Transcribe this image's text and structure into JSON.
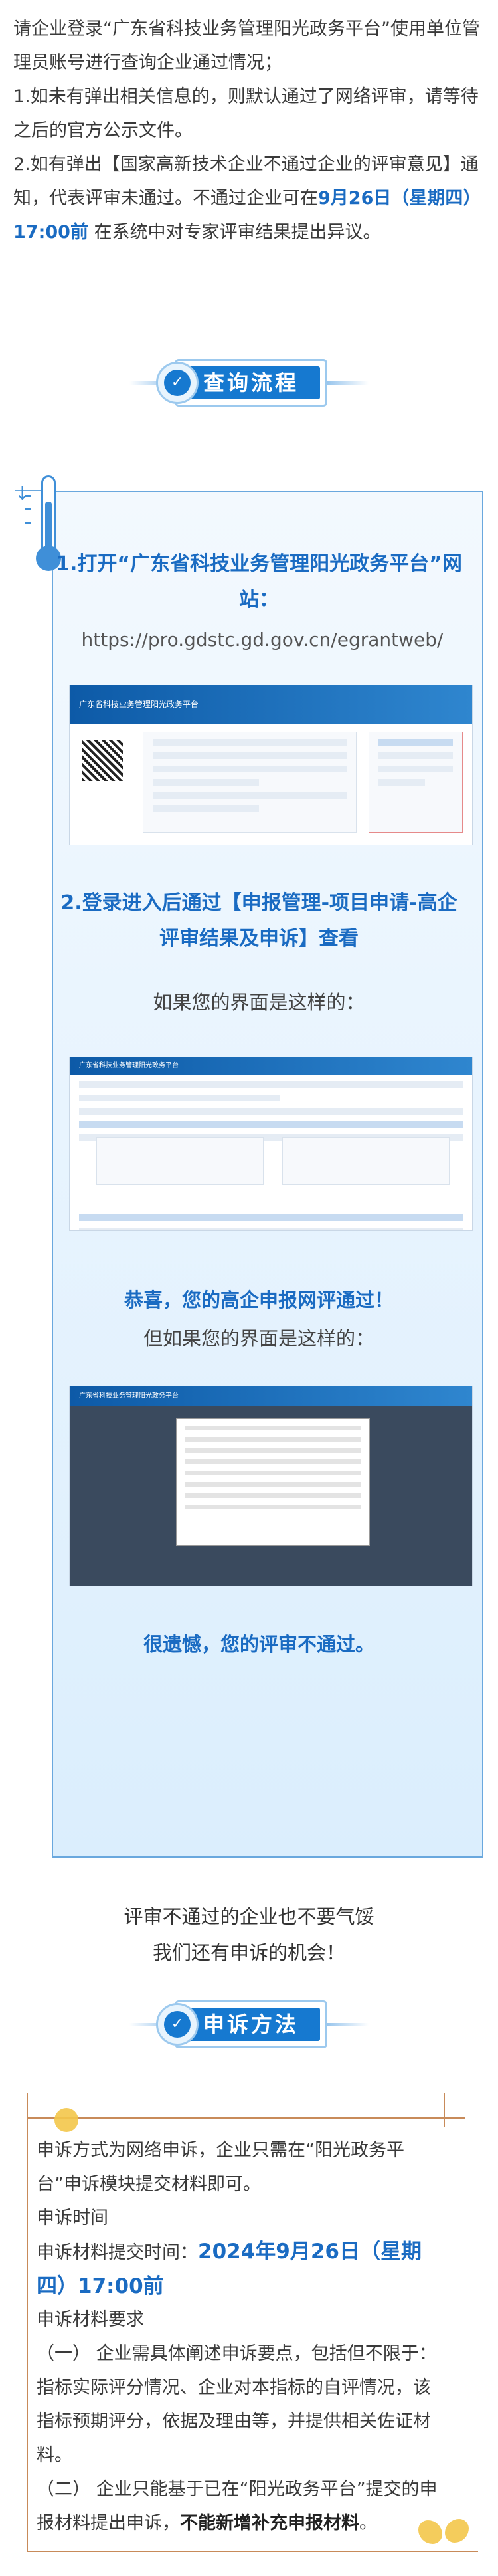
{
  "intro": {
    "p1": "请企业登录“广东省科技业务管理阳光政务平台”使用单位管理员账号进行查询企业通过情况；",
    "p2": "1.如未有弹出相关信息的，则默认通过了网络评审，请等待之后的官方公示文件。",
    "p3a": "2.如有弹出【国家高新技术企业不通过企业的评审意见】通知，代表评审未通过。不通过企业可在",
    "p3b": "9月26日（星期四）17:00前",
    "p3c": " 在系统中对专家评审结果提出异议。"
  },
  "sections": {
    "query_title": "查询流程",
    "appeal_title": "申诉方法"
  },
  "steps": {
    "step1_title": "1.打开“广东省科技业务管理阳光政务平台”网站：",
    "step1_url": "https://pro.gdstc.gd.gov.cn/egrantweb/",
    "step2_title": "2.登录进入后通过【申报管理-项目申请-高企评审结果及申诉】查看",
    "if_like_this": "如果您的界面是这样的：",
    "pass_msg": "恭喜，您的高企申报网评通过！",
    "but_if": "但如果您的界面是这样的：",
    "fail_msg": "很遗憾，您的评审不通过。"
  },
  "screenshots": {
    "s1_header": "广东省科技业务管理阳光政务平台",
    "s2_header": "广东省科技业务管理阳光政务平台",
    "s3_header": "广东省科技业务管理阳光政务平台"
  },
  "closing": {
    "line1": "评审不通过的企业也不要气馁",
    "line2": "我们还有申诉的机会！"
  },
  "appeal": {
    "p1": "申诉方式为网络申诉，企业只需在“阳光政务平台”申诉模块提交材料即可。",
    "time_label": "申诉时间",
    "submit_label": "申诉材料提交时间：",
    "submit_time": "2024年9月26日（星期四）17:00前",
    "req_label": "申诉材料要求",
    "req1": "（一） 企业需具体阐述申诉要点，包括但不限于：指标实际评分情况、企业对本指标的自评情况，该指标预期评分，依据及理由等，并提供相关佐证材料。",
    "req2a": "（二） 企业只能基于已在“阳光政务平台”提交的申报材料提出申诉，",
    "req2b": "不能新增补充申报材料",
    "req2c": "。"
  },
  "colors": {
    "accent": "#1a6bc2",
    "frame": "#6aa8de",
    "appeal_frame": "#c88b5a"
  }
}
